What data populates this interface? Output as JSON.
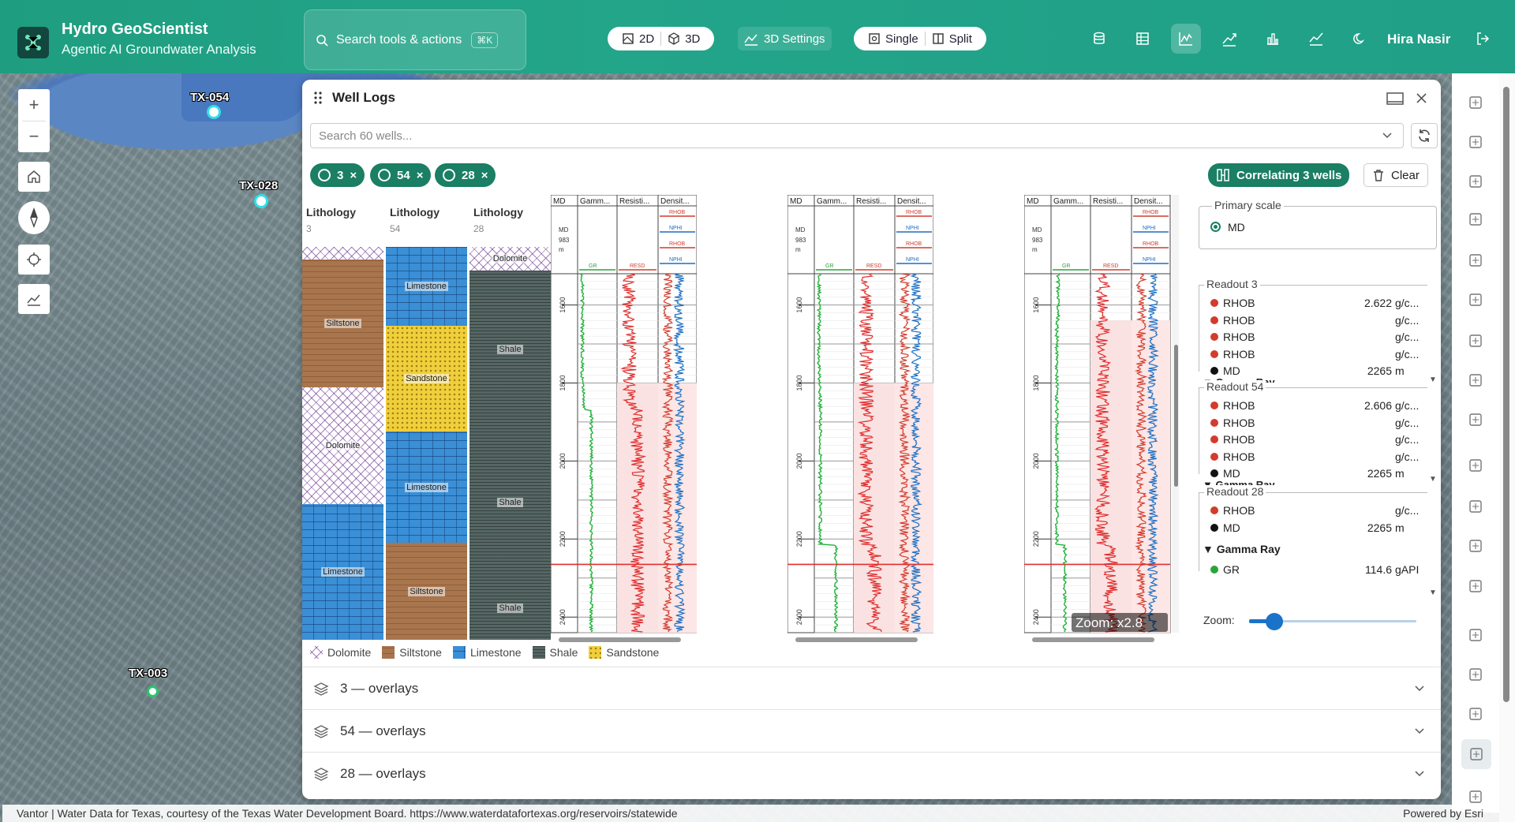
{
  "header": {
    "app_title": "Hydro GeoScientist",
    "app_subtitle": "Agentic AI Groundwater Analysis",
    "search_label": "Search tools & actions",
    "search_shortcut": "⌘K",
    "view_2d": "2D",
    "view_3d": "3D",
    "settings_3d": "3D Settings",
    "layout_single": "Single",
    "layout_split": "Split",
    "user_name": "Hira Nasir",
    "colors": {
      "header": "#1f9d80",
      "accent": "#1a7f64"
    }
  },
  "map": {
    "wells": [
      {
        "label": "TX-054"
      },
      {
        "label": "TX-028"
      },
      {
        "label": "TX-003"
      }
    ],
    "controls": {
      "zoom_in": "+",
      "zoom_out": "−"
    }
  },
  "panel": {
    "title": "Well Logs",
    "search_placeholder": "Search 60 wells...",
    "chips": [
      {
        "label": "3"
      },
      {
        "label": "54"
      },
      {
        "label": "28"
      }
    ],
    "correlating_label": "Correlating 3 wells",
    "clear_label": "Clear",
    "lithology": [
      {
        "title": "Lithology",
        "well": "3",
        "units": [
          "Siltstone",
          "Dolomite",
          "Limestone"
        ]
      },
      {
        "title": "Lithology",
        "well": "54",
        "units": [
          "Limestone",
          "Sandstone",
          "Limestone",
          "Siltstone"
        ]
      },
      {
        "title": "Lithology",
        "well": "28",
        "units": [
          "Dolomite",
          "Shale",
          "Shale",
          "Shale"
        ]
      }
    ],
    "tracks": {
      "headers": [
        "MD",
        "Gamm...",
        "Resisti...",
        "Densit..."
      ],
      "md_label": "MD",
      "md_value": "983",
      "md_unit": "m",
      "depth_ticks": [
        "1600",
        "1800",
        "2000",
        "2200",
        "2400"
      ],
      "curve_labels": [
        "GR",
        "RESD",
        "RHOB",
        "NPHI"
      ],
      "zoom_overlay": "Zoom: x2.8"
    },
    "legend": [
      {
        "name": "Dolomite",
        "color": "#b77fd2"
      },
      {
        "name": "Siltstone",
        "color": "#a9754d"
      },
      {
        "name": "Limestone",
        "color": "#3a8fd6"
      },
      {
        "name": "Shale",
        "color": "#556663"
      },
      {
        "name": "Sandstone",
        "color": "#f0cf3c"
      }
    ],
    "readout": {
      "primary_scale_label": "Primary scale",
      "primary_scale_value": "MD",
      "groups": [
        {
          "title": "Readout 3",
          "rows": [
            {
              "name": "RHOB",
              "value": "2.622",
              "unit": "g/c...",
              "color": "#d23c2c"
            },
            {
              "name": "RHOB",
              "value": "",
              "unit": "g/c...",
              "color": "#d23c2c"
            },
            {
              "name": "RHOB",
              "value": "",
              "unit": "g/c...",
              "color": "#d23c2c"
            },
            {
              "name": "RHOB",
              "value": "",
              "unit": "g/c...",
              "color": "#d23c2c"
            },
            {
              "name": "MD",
              "value": "2265",
              "unit": "m",
              "color": "#111111"
            }
          ],
          "cut_label": "▼ Gamma Ray"
        },
        {
          "title": "Readout 54",
          "rows": [
            {
              "name": "RHOB",
              "value": "2.606",
              "unit": "g/c...",
              "color": "#d23c2c"
            },
            {
              "name": "RHOB",
              "value": "",
              "unit": "g/c...",
              "color": "#d23c2c"
            },
            {
              "name": "RHOB",
              "value": "",
              "unit": "g/c...",
              "color": "#d23c2c"
            },
            {
              "name": "RHOB",
              "value": "",
              "unit": "g/c...",
              "color": "#d23c2c"
            },
            {
              "name": "MD",
              "value": "2265",
              "unit": "m",
              "color": "#111111"
            }
          ],
          "cut_label": "▼ Gamma Ray"
        },
        {
          "title": "Readout 28",
          "rows": [
            {
              "name": "RHOB",
              "value": "",
              "unit": "g/c...",
              "color": "#d23c2c"
            },
            {
              "name": "MD",
              "value": "2265",
              "unit": "m",
              "color": "#111111"
            }
          ],
          "section": "▼ Gamma Ray",
          "gr": {
            "name": "GR",
            "value": "114.6",
            "unit": "gAPI",
            "color": "#2aa43a"
          }
        }
      ],
      "zoom_label": "Zoom:",
      "zoom_level": 0.15
    },
    "overlays": [
      {
        "label": "3 — overlays"
      },
      {
        "label": "54 — overlays"
      },
      {
        "label": "28 — overlays"
      }
    ]
  },
  "footer": {
    "attribution": "Vantor | Water Data for Texas, courtesy of the Texas Water Development Board. https://www.waterdatafortexas.org/reservoirs/statewide",
    "powered": "Powered by Esri"
  }
}
